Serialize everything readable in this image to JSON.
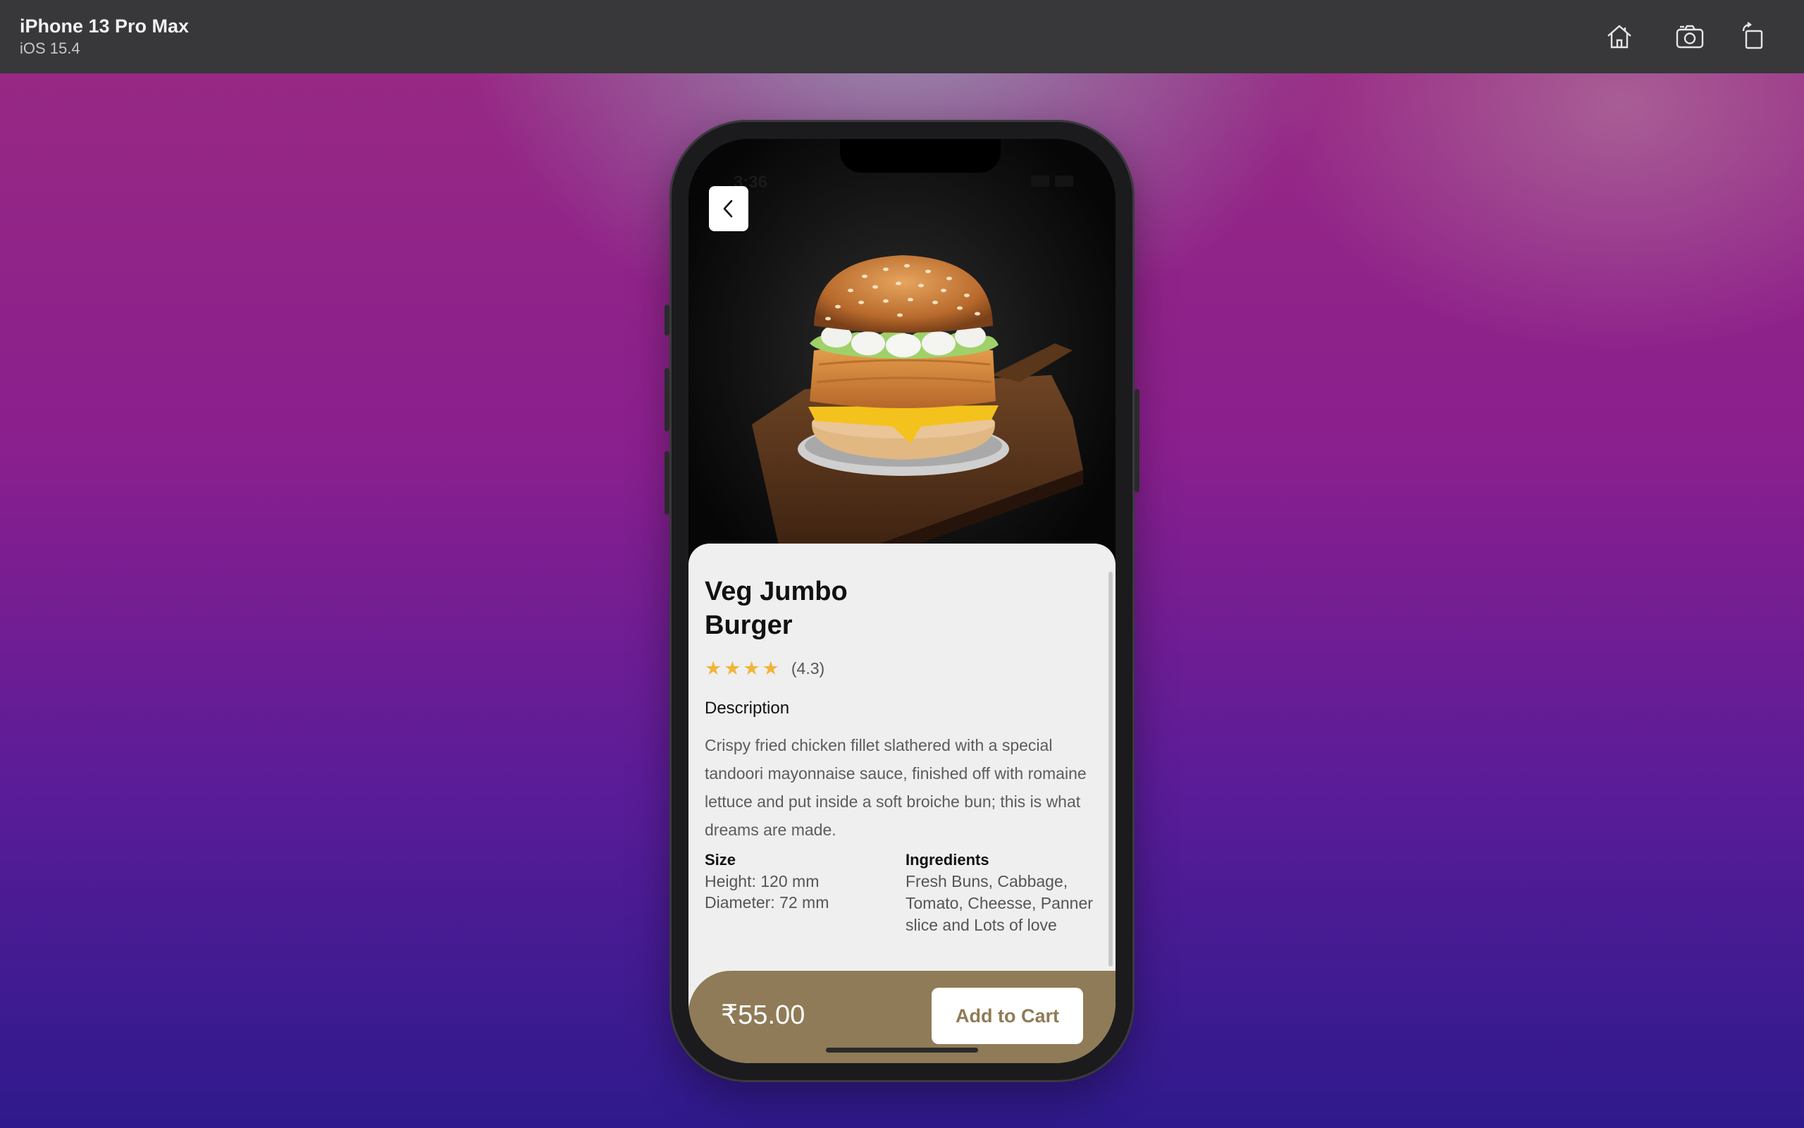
{
  "simulator": {
    "device_name": "iPhone 13 Pro Max",
    "os_version": "iOS 15.4",
    "toolbar_icons": [
      "home-icon",
      "screenshot-icon",
      "rotate-icon"
    ]
  },
  "status_bar": {
    "time": "3:36"
  },
  "product": {
    "name_line1": "Veg Jumbo",
    "name_line2": "Burger",
    "rating_stars": 4,
    "rating_text": "(4.3)",
    "description_heading": "Description",
    "description": "Crispy fried chicken fillet slathered with a special tandoori mayonnaise sauce, finished off with romaine lettuce and put inside a soft broiche bun; this is what dreams are made.",
    "size_heading": "Size",
    "height": "Height: 120 mm",
    "diameter": "Diameter: 72 mm",
    "ingredients_heading": "Ingredients",
    "ingredients": "Fresh Buns, Cabbage, Tomato, Cheesse, Panner slice and Lots of love"
  },
  "purchase": {
    "price": "₹55.00",
    "add_to_cart_label": "Add to Cart"
  },
  "colors": {
    "accent": "#8f7b57",
    "star": "#f0b53a",
    "card_bg": "#efefef"
  }
}
